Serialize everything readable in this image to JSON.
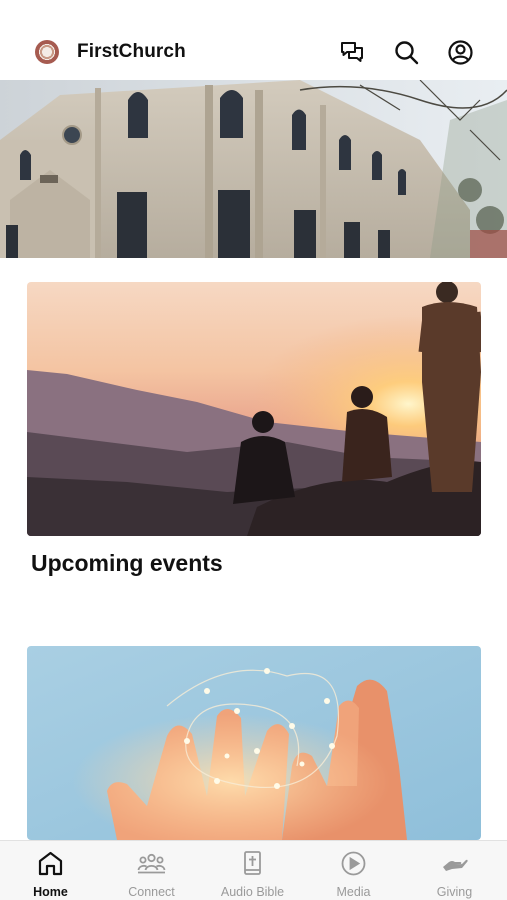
{
  "header": {
    "app_title": "FirstChurch",
    "icons": [
      "chat-icon",
      "search-icon",
      "profile-icon"
    ]
  },
  "sections": [
    {
      "title": "Upcoming events"
    }
  ],
  "tabbar": {
    "active": "Home",
    "tabs": [
      {
        "label": "Home",
        "icon": "home-icon"
      },
      {
        "label": "Connect",
        "icon": "people-icon"
      },
      {
        "label": "Audio Bible",
        "icon": "bible-icon"
      },
      {
        "label": "Media",
        "icon": "play-icon"
      },
      {
        "label": "Giving",
        "icon": "giving-hand-icon"
      }
    ]
  },
  "colors": {
    "active_tab": "#111111",
    "inactive_tab": "#9a9a9a",
    "tabbar_bg": "#f7f7f7"
  }
}
